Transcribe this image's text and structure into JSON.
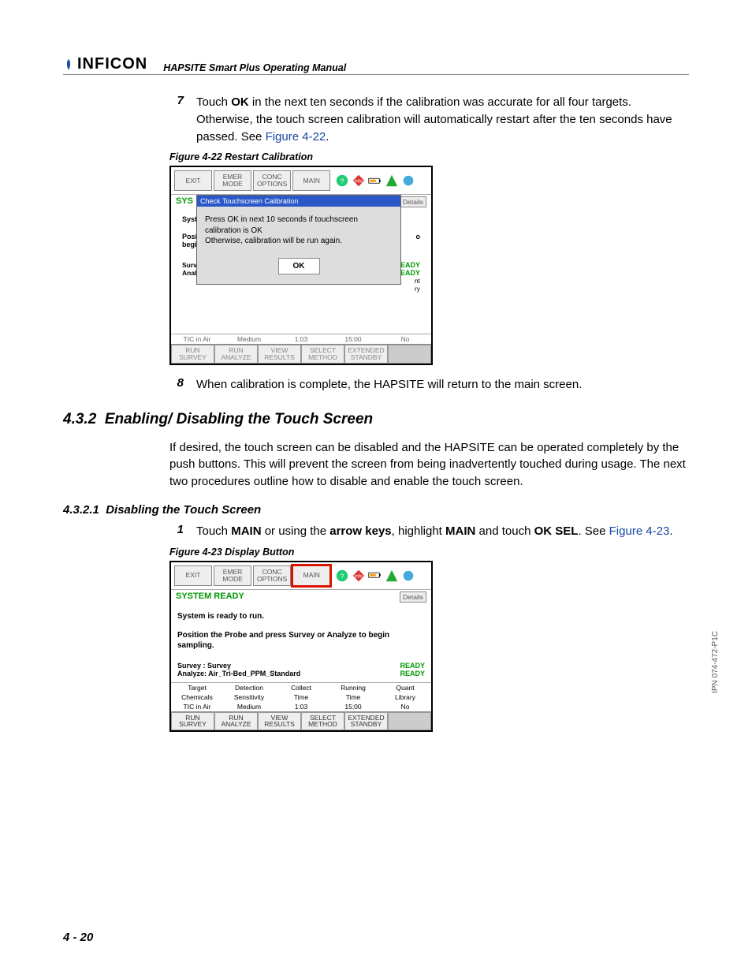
{
  "header": {
    "brand": "INFICON",
    "doc_title": "HAPSITE Smart Plus Operating Manual"
  },
  "side_code": "IPN 074-472-P1C",
  "page_number": "4 - 20",
  "step7": {
    "num": "7",
    "t1": "Touch ",
    "b1": "OK",
    "t2": " in the next ten seconds if the calibration was accurate for all four targets. Otherwise, the touch screen calibration will automatically restart after the ten seconds have passed. See ",
    "link": "Figure 4-22",
    "t3": "."
  },
  "fig22_caption": "Figure 4-22  Restart Calibration",
  "fig22": {
    "toolbar": {
      "exit": "EXIT",
      "emer1": "EMER",
      "emer2": "MODE",
      "conc1": "CONC",
      "conc2": "OPTIONS",
      "main": "MAIN"
    },
    "sys_trunc": "SYS",
    "details": "Details",
    "bg_left": {
      "syst": "Syst",
      "posi": "Posi",
      "begi": "begi",
      "surv": "Surve",
      "analy": "Analy"
    },
    "bg_right": {
      "o": "o",
      "ready": "EADY",
      "nt": "nt",
      "ry": "ry",
      "no": "No"
    },
    "dialog": {
      "title": "Check Touchscreen Calibration",
      "line1": "Press OK in next 10 seconds if touchscreen calibration is OK",
      "line2": "Otherwise, calibration will be run again.",
      "ok": "OK"
    },
    "datastrip": {
      "tic": "TIC in Air",
      "med": "Medium",
      "t1": "1:03",
      "t2": "15:00",
      "no": "No"
    },
    "footer": {
      "runsurv1": "RUN",
      "runsurv2": "SURVEY",
      "runana1": "RUN",
      "runana2": "ANALYZE",
      "view1": "VIEW",
      "view2": "RESULTS",
      "sel1": "SELECT",
      "sel2": "METHOD",
      "ext1": "EXTENDED",
      "ext2": "STANDBY"
    }
  },
  "step8": {
    "num": "8",
    "text": "When calibration is complete, the HAPSITE will return to the main screen."
  },
  "sec432": {
    "num": "4.3.2",
    "title": "Enabling/ Disabling the Touch Screen",
    "para": "If desired, the touch screen can be disabled and the HAPSITE can be operated completely by the push buttons. This will prevent the screen from being inadvertently touched during usage. The next two procedures outline how to disable and enable the touch screen."
  },
  "sec4321": {
    "num": "4.3.2.1",
    "title": "Disabling the Touch Screen"
  },
  "step1": {
    "num": "1",
    "t1": "Touch ",
    "b1": "MAIN",
    "t2": " or using the ",
    "b2": "arrow keys",
    "t3": ", highlight ",
    "b3": "MAIN",
    "t4": " and touch ",
    "b4": "OK SEL",
    "t5": ". See ",
    "link": "Figure 4-23",
    "t6": "."
  },
  "fig23_caption": "Figure 4-23  Display Button",
  "fig23": {
    "toolbar": {
      "exit": "EXIT",
      "emer1": "EMER",
      "emer2": "MODE",
      "conc1": "CONC",
      "conc2": "OPTIONS",
      "main": "MAIN"
    },
    "sysready": "SYSTEM READY",
    "details": "Details",
    "line1": "System is ready to run.",
    "line2": "Position the Probe and press Survey or Analyze to begin sampling.",
    "survey_lbl": "Survey : Survey",
    "analyze_lbl": "Analyze: Air_Tri-Bed_PPM_Standard",
    "ready": "READY",
    "grid": {
      "h1": "Target",
      "h2": "Detection",
      "h3": "Collect",
      "h4": "Running",
      "h5": "Quant",
      "r1": "Chemicals",
      "r2": "Sensitivity",
      "r3": "Time",
      "r4": "Time",
      "r5": "Library",
      "d1": "TIC in Air",
      "d2": "Medium",
      "d3": "1:03",
      "d4": "15:00",
      "d5": "No"
    },
    "footer": {
      "runsurv1": "RUN",
      "runsurv2": "SURVEY",
      "runana1": "RUN",
      "runana2": "ANALYZE",
      "view1": "VIEW",
      "view2": "RESULTS",
      "sel1": "SELECT",
      "sel2": "METHOD",
      "ext1": "EXTENDED",
      "ext2": "STANDBY"
    }
  }
}
